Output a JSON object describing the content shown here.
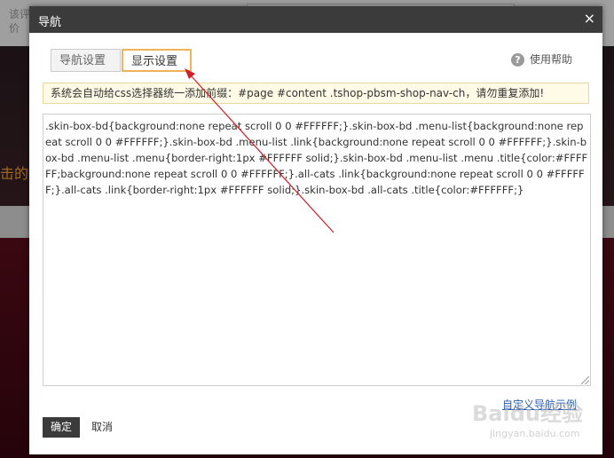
{
  "background": {
    "top_text": "该评价",
    "band_text": "击的"
  },
  "modal": {
    "title": "导航",
    "close_glyph": "×",
    "tabs": [
      {
        "label": "导航设置",
        "active": false
      },
      {
        "label": "显示设置",
        "active": true
      }
    ],
    "help": {
      "icon": "?",
      "label": "使用帮助"
    },
    "notice": "系统会自动给css选择器统一添加前缀：#page #content .tshop-pbsm-shop-nav-ch，请勿重复添加!",
    "css_value": ".skin-box-bd{background:none repeat scroll 0 0 #FFFFFF;}.skin-box-bd .menu-list{background:none repeat scroll 0 0 #FFFFFF;}.skin-box-bd .menu-list .link{background:none repeat scroll 0 0 #FFFFFF;}.skin-box-bd .menu-list .menu{border-right:1px #FFFFFF solid;}.skin-box-bd .menu-list .menu .title{color:#FFFFFF;background:none repeat scroll 0 0 #FFFFFF;}.all-cats .link{background:none repeat scroll 0 0 #FFFFFF;}.all-cats .link{border-right:1px #FFFFFF solid;}.skin-box-bd .all-cats .title{color:#FFFFFF;}",
    "example_link": "自定义导航示例",
    "ok_label": "确定",
    "cancel_label": "取消"
  },
  "watermark": {
    "big": "Baidu经验",
    "small": "jingyan.baidu.com"
  },
  "colors": {
    "titlebar": "#3b3b3b",
    "active_tab_border": "#f0b35a",
    "notice_bg": "#fffbe6",
    "link": "#2a5db0",
    "arrow": "#d0202a"
  }
}
